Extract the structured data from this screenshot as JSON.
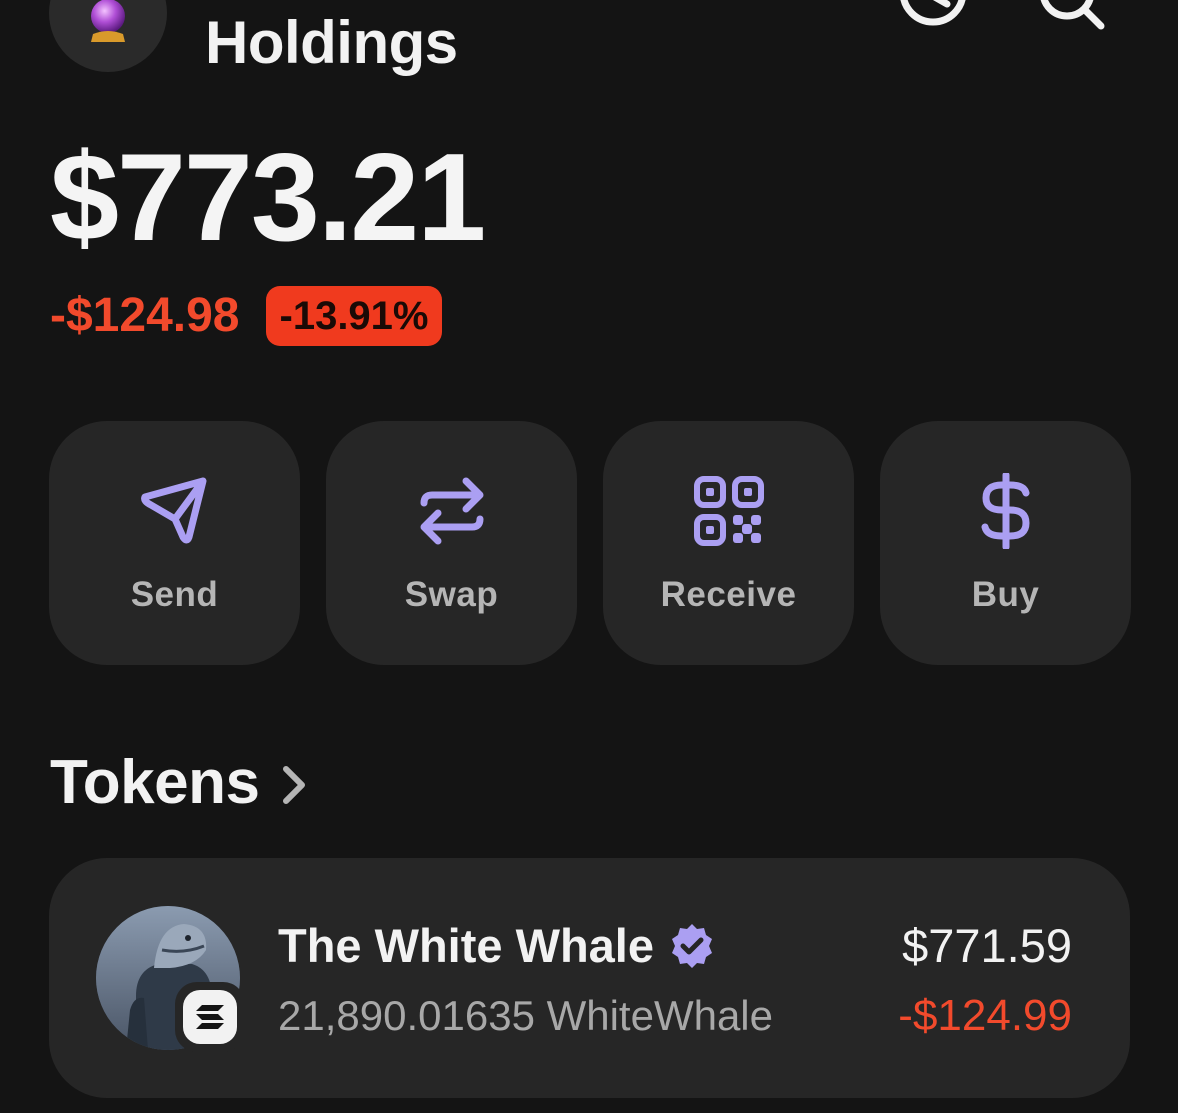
{
  "header": {
    "title": "Holdings",
    "avatar_icon": "crystal-ball-icon",
    "history_icon": "clock-icon",
    "search_icon": "search-icon"
  },
  "balance": {
    "total": "$773.21",
    "change_amount": "-$124.98",
    "change_percent": "-13.91%"
  },
  "actions": [
    {
      "label": "Send",
      "icon": "send-icon"
    },
    {
      "label": "Swap",
      "icon": "swap-icon"
    },
    {
      "label": "Receive",
      "icon": "qr-code-icon"
    },
    {
      "label": "Buy",
      "icon": "dollar-icon"
    }
  ],
  "tokens": {
    "heading": "Tokens",
    "items": [
      {
        "name": "The White Whale",
        "verified": true,
        "quantity": "21,890.01635 WhiteWhale",
        "value": "$771.59",
        "change": "-$124.99",
        "chain_icon": "solana-icon"
      }
    ]
  },
  "colors": {
    "background": "#141414",
    "card": "#262626",
    "accent": "#ab9ff2",
    "negative": "#f24a2c"
  }
}
